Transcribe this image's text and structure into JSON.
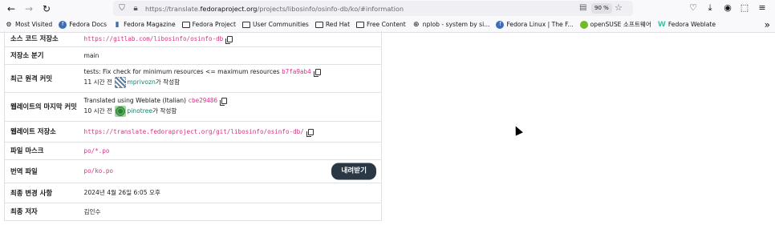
{
  "browser": {
    "url_prefix": "https://translate.",
    "url_domain": "fedoraproject.org",
    "url_suffix": "/projects/libosinfo/osinfo-db/ko/#information",
    "zoom": "90 %"
  },
  "bookmarks": [
    {
      "label": "Most Visited",
      "icon": "gear-icon"
    },
    {
      "label": "Fedora Docs",
      "icon": "fedora-icon"
    },
    {
      "label": "Fedora Magazine",
      "icon": "bookmark-icon"
    },
    {
      "label": "Fedora Project",
      "icon": "folder-icon"
    },
    {
      "label": "User Communities",
      "icon": "folder-icon"
    },
    {
      "label": "Red Hat",
      "icon": "folder-icon"
    },
    {
      "label": "Free Content",
      "icon": "folder-icon"
    },
    {
      "label": "nplob - system by si...",
      "icon": "globe-icon"
    },
    {
      "label": "Fedora Linux | The F...",
      "icon": "fedora-icon"
    },
    {
      "label": "openSUSE 소프트웨어",
      "icon": "opensuse-icon"
    },
    {
      "label": "Fedora Weblate",
      "icon": "weblate-icon"
    }
  ],
  "info": {
    "source_repo_label": "소스 코드 저장소",
    "source_repo_value": "https://gitlab.com/libosinfo/osinfo-db",
    "branch_label": "저장소 분기",
    "branch_value": "main",
    "remote_commit_label": "최근 원격 커밋",
    "remote_commit_msg": "tests: Fix check for minimum resources <= maximum resources",
    "remote_commit_hash": "b7fa9ab4",
    "remote_commit_time": "11 시간 전",
    "remote_commit_user": "mprivozn",
    "remote_commit_suffix": "가 작성함",
    "weblate_commit_label": "웹레이트의 마지막 커밋",
    "weblate_commit_msg": "Translated using Weblate (Italian)",
    "weblate_commit_hash": "cbe29486",
    "weblate_commit_time": "10 시간 전",
    "weblate_commit_user": "pinotree",
    "weblate_commit_suffix": "가 작성함",
    "weblate_repo_label": "웹레이트 저장소",
    "weblate_repo_value": "https://translate.fedoraproject.org/git/libosinfo/osinfo-db/",
    "file_mask_label": "파일 마스크",
    "file_mask_value": "po/*.po",
    "translation_file_label": "번역 파일",
    "translation_file_value": "po/ko.po",
    "download_label": "내려받기",
    "last_change_label": "최종 변경 사항",
    "last_change_value": "2024년 4월 26일 6:05 오후",
    "last_author_label": "최종 저자",
    "last_author_value": "김인수"
  }
}
